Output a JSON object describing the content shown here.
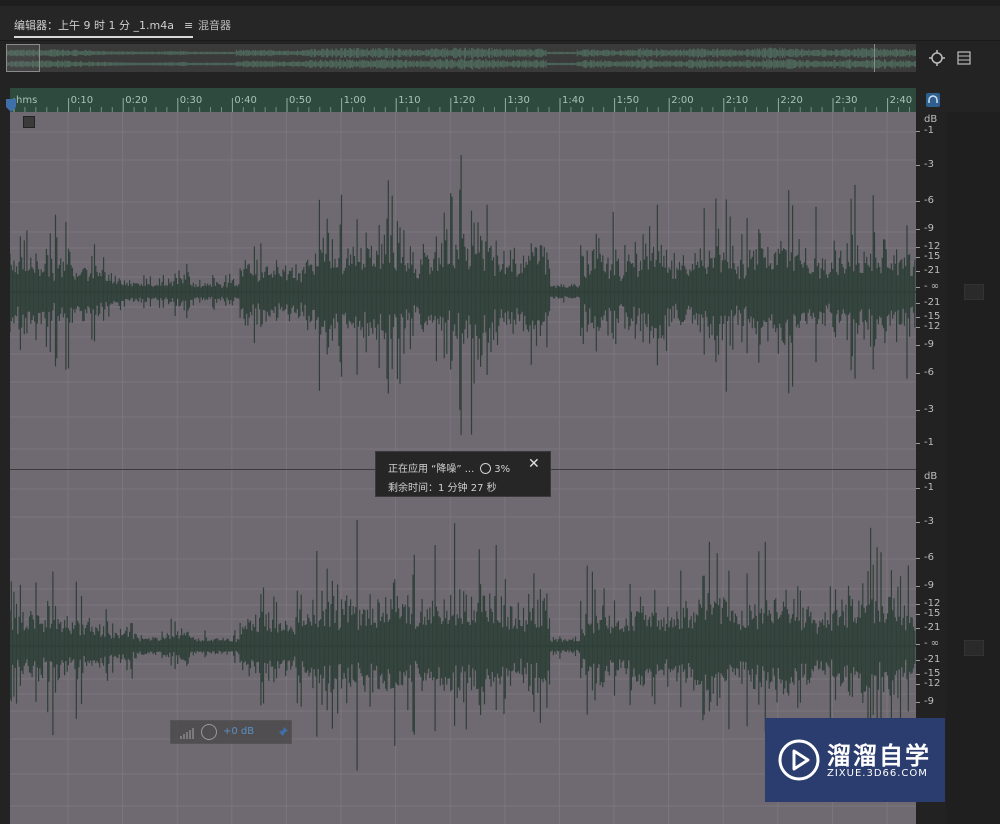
{
  "tabs": {
    "editor_label": "编辑器：上午 9 时 1 分 _1.m4a",
    "editor_menu_icon": "≡",
    "mixer_label": "混音器"
  },
  "ruler": {
    "ticks": [
      "hms",
      "0:10",
      "0:20",
      "0:30",
      "0:40",
      "0:50",
      "1:00",
      "1:10",
      "1:20",
      "1:30",
      "1:40",
      "1:50",
      "2:00",
      "2:10",
      "2:20",
      "2:30",
      "2:40"
    ]
  },
  "db_scale": {
    "unit": "dB",
    "labels": [
      "-1",
      "-3",
      "-6",
      "-9",
      "-12",
      "-15",
      "-21",
      "- ∞",
      "-21",
      "-15",
      "-12",
      "-9",
      "-6",
      "-3",
      "-1"
    ]
  },
  "progress_dialog": {
    "status_text": "正在应用 “降噪” ...",
    "percent": "3%",
    "remaining_text": "剩余时间：1 分钟 27 秒",
    "close_glyph": "✕"
  },
  "hud": {
    "volume_value": "+0 dB"
  },
  "watermark": {
    "brand_cn": "溜溜自学",
    "url": "ZIXUE.3D66.COM"
  },
  "colors": {
    "wave_bg": "#6f6a72",
    "waveform": "#2f4038",
    "ruler_bg": "#2e4a3f",
    "watermark_bg": "#2b3d6e"
  }
}
